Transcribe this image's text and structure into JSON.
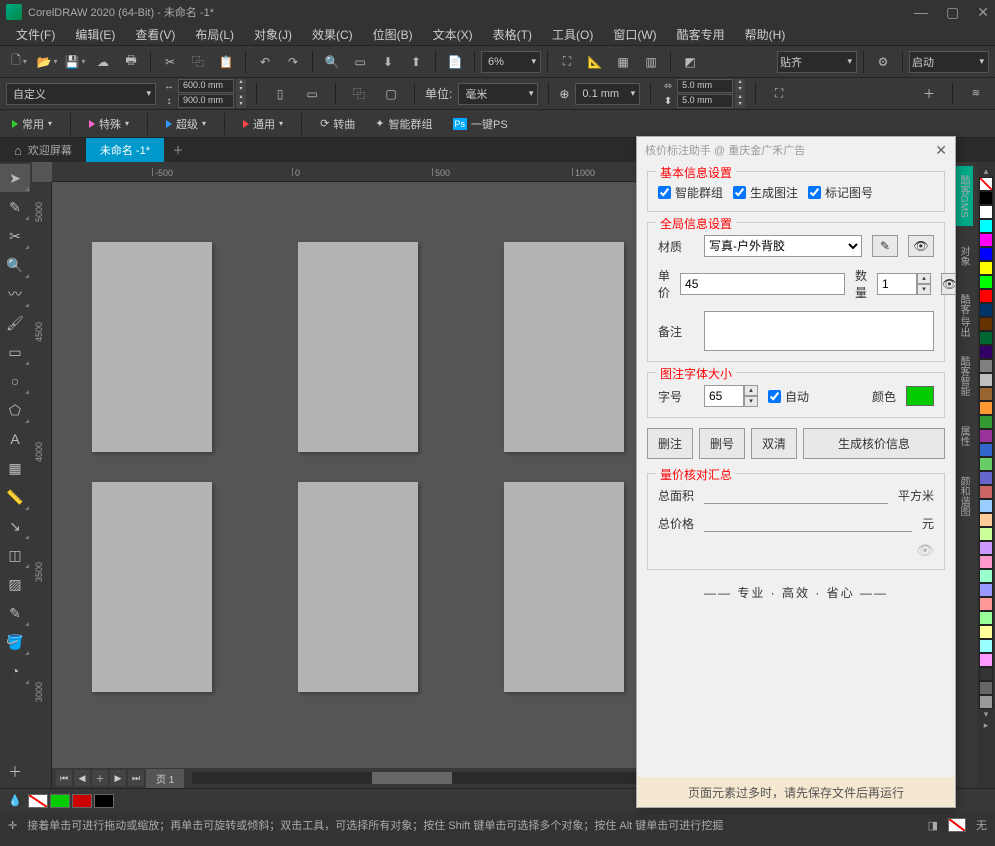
{
  "app_title": "CorelDRAW 2020 (64-Bit) - 未命名 -1*",
  "menu": [
    "文件(F)",
    "编辑(E)",
    "查看(V)",
    "布局(L)",
    "对象(J)",
    "效果(C)",
    "位图(B)",
    "文本(X)",
    "表格(T)",
    "工具(O)",
    "窗口(W)",
    "酷客专用",
    "帮助(H)"
  ],
  "toolbar1": {
    "zoom": "6%",
    "snap": "贴齐",
    "launch": "启动"
  },
  "propbar": {
    "preset": "自定义",
    "width": "600.0 mm",
    "height": "900.0 mm",
    "unit_label": "单位:",
    "unit": "毫米",
    "nudge": "0.1 mm",
    "dup_x": "5.0 mm",
    "dup_y": "5.0 mm"
  },
  "plugins": {
    "p1": "常用",
    "p2": "特殊",
    "p3": "超级",
    "p4": "通用",
    "p5": "转曲",
    "p6": "智能群组",
    "p7": "一键PS"
  },
  "tabs": {
    "welcome": "欢迎屏幕",
    "doc": "未命名 -1*"
  },
  "ruler_h": [
    "-500",
    "0",
    "500",
    "1000"
  ],
  "ruler_v": [
    "5000",
    "4500",
    "4000",
    "3500",
    "3000"
  ],
  "page_nav": {
    "label": "页 1"
  },
  "statusbar": {
    "hint": "接着单击可进行拖动或缩放；再单击可旋转或倾斜；双击工具，可选择所有对象；按住 Shift 键单击可选择多个对象；按住 Alt 键单击可进行挖掘",
    "fill": "无"
  },
  "colors": [
    "#000000",
    "#ffffff",
    "#00ffff",
    "#ff00ff",
    "#0000ff",
    "#ffff00",
    "#00ff00",
    "#ff0000",
    "#003366",
    "#663300",
    "#006633",
    "#330066",
    "#808080",
    "#c0c0c0",
    "#996633",
    "#ff9933",
    "#339933",
    "#993399",
    "#3366cc",
    "#66cc66",
    "#6666cc",
    "#cc6666",
    "#99ccff",
    "#ffcc99",
    "#ccff99",
    "#cc99ff",
    "#ff99cc"
  ],
  "panel": {
    "title": "核价标注助手 @ 重庆金广禾广告",
    "basic_legend": "基本信息设置",
    "chk1": "智能群组",
    "chk2": "生成图注",
    "chk3": "标记图号",
    "global_legend": "全局信息设置",
    "material_label": "材质",
    "material_value": "写真-户外背胶",
    "price_label": "单价",
    "price_value": "45",
    "qty_label": "数量",
    "qty_value": "1",
    "note_label": "备注",
    "font_legend": "图注字体大小",
    "fontsize_label": "字号",
    "fontsize_value": "65",
    "auto_label": "自动",
    "color_label": "颜色",
    "color_value": "#00cc00",
    "btn1": "删注",
    "btn2": "删号",
    "btn3": "双清",
    "btn4": "生成核价信息",
    "summary_legend": "量价核对汇总",
    "area_label": "总面积",
    "area_unit": "平方米",
    "total_label": "总价格",
    "total_unit": "元",
    "tagline": "—— 专业 · 高效 · 省心 ——",
    "footer": "页面元素过多时，请先保存文件后再运行"
  }
}
